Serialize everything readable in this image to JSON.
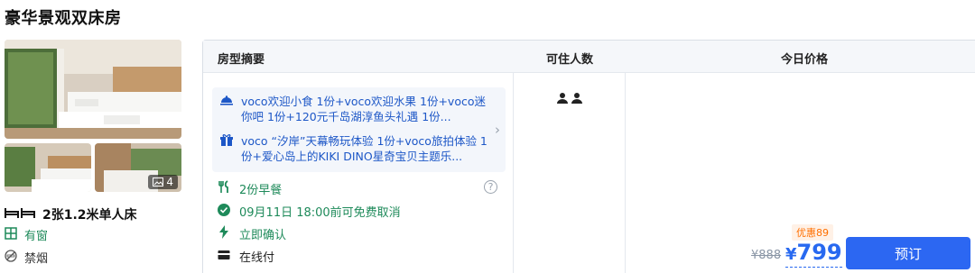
{
  "room": {
    "title": "豪华景观双床房",
    "photo_count": "4",
    "bed": "2张1.2米单人床",
    "window": "有窗",
    "smoking": "禁烟"
  },
  "table": {
    "headers": {
      "summary": "房型摘要",
      "guests": "可住人数",
      "price": "今日价格"
    },
    "packages": [
      {
        "icon": "dining-cloche-icon",
        "text": "voco欢迎小食 1份+voco欢迎水果 1份+voco迷你吧 1份+120元千岛湖淳鱼头礼遇 1份..."
      },
      {
        "icon": "gift-icon",
        "text": "voco “汐岸”天幕畅玩体验 1份+voco旅拍体验 1份+爱心岛上的KIKI DINO星奇宝贝主题乐..."
      }
    ],
    "features": {
      "meal": "2份早餐",
      "cancel": "09月11日 18:00前可免费取消",
      "confirm": "立即确认",
      "payment": "在线付"
    },
    "guests_count": 2,
    "pricing": {
      "discount_label": "优惠89",
      "original_price": "¥888",
      "currency": "¥",
      "price": "799",
      "book_label": "预订"
    }
  },
  "colors": {
    "accent_blue": "#2c67f2",
    "green": "#1e8a5a",
    "discount_orange": "#ff6f00",
    "header_bg": "#f5f7fa"
  }
}
